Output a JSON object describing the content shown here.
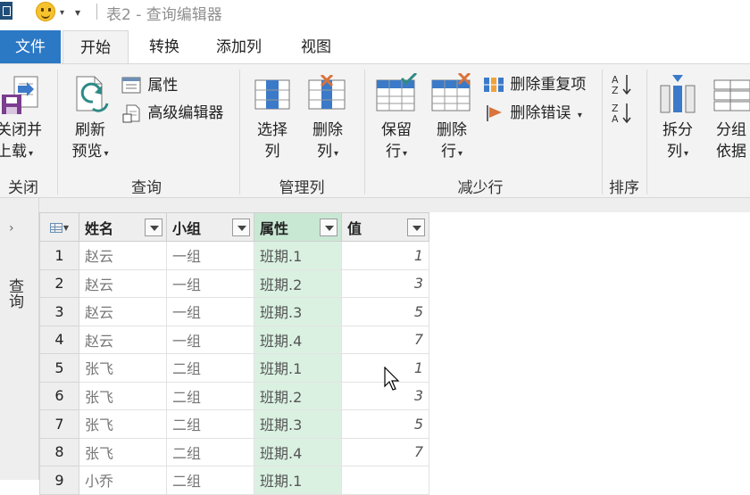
{
  "titlebar": {
    "title": "表2 - 查询编辑器",
    "qa_drop": "▾",
    "qa_drop2": "="
  },
  "tabs": [
    "文件",
    "开始",
    "转换",
    "添加列",
    "视图"
  ],
  "ribbon": {
    "close_group": {
      "button": [
        "关闭并",
        "上载"
      ],
      "label": "关闭"
    },
    "query_group": {
      "refresh": [
        "刷新",
        "预览"
      ],
      "properties": "属性",
      "advanced_editor": "高级编辑器",
      "label": "查询"
    },
    "manage_cols_group": {
      "choose": [
        "选择",
        "列"
      ],
      "remove": [
        "删除",
        "列"
      ],
      "label": "管理列"
    },
    "reduce_rows_group": {
      "keep": [
        "保留",
        "行"
      ],
      "remove": [
        "删除",
        "行"
      ],
      "remove_duplicates": "删除重复项",
      "remove_errors": "删除错误",
      "label": "减少行"
    },
    "sort_group": {
      "label": "排序"
    },
    "split_group": {
      "split": [
        "拆分",
        "列"
      ],
      "group_by": [
        "分组",
        "依据"
      ]
    }
  },
  "side_pane": {
    "label": "查询"
  },
  "grid": {
    "columns": [
      "姓名",
      "小组",
      "属性",
      "值"
    ],
    "rows": [
      {
        "idx": "1",
        "name": "赵云",
        "group": "一组",
        "attr": "班期.1",
        "val": "1"
      },
      {
        "idx": "2",
        "name": "赵云",
        "group": "一组",
        "attr": "班期.2",
        "val": "3"
      },
      {
        "idx": "3",
        "name": "赵云",
        "group": "一组",
        "attr": "班期.3",
        "val": "5"
      },
      {
        "idx": "4",
        "name": "赵云",
        "group": "一组",
        "attr": "班期.4",
        "val": "7"
      },
      {
        "idx": "5",
        "name": "张飞",
        "group": "二组",
        "attr": "班期.1",
        "val": "1"
      },
      {
        "idx": "6",
        "name": "张飞",
        "group": "二组",
        "attr": "班期.2",
        "val": "3"
      },
      {
        "idx": "7",
        "name": "张飞",
        "group": "二组",
        "attr": "班期.3",
        "val": "5"
      },
      {
        "idx": "8",
        "name": "张飞",
        "group": "二组",
        "attr": "班期.4",
        "val": "7"
      },
      {
        "idx": "9",
        "name": "小乔",
        "group": "二组",
        "attr": "班期.1",
        "val": ""
      }
    ]
  },
  "colors": {
    "file_tab": "#2b78c5",
    "selected_col": "#daf1e2",
    "ribbon_bg": "#f3f3f3"
  }
}
